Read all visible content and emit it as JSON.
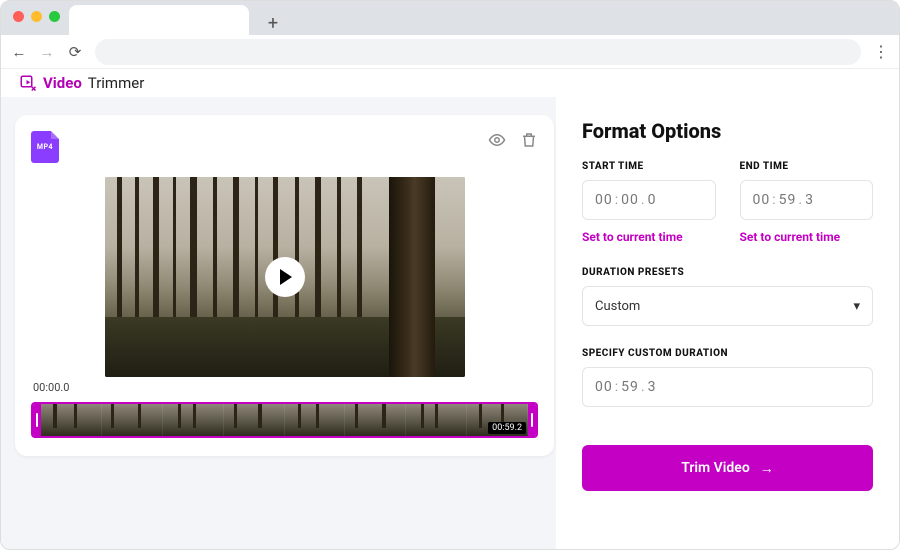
{
  "app": {
    "name1": "Video",
    "name2": "Trimmer"
  },
  "file": {
    "badge": "MP4"
  },
  "player": {
    "current_time": "00:00.0"
  },
  "timeline": {
    "end_label": "00:59.2"
  },
  "panel": {
    "title": "Format Options",
    "start": {
      "label": "START TIME",
      "hh": "00",
      "mm": "00",
      "d": "0",
      "link": "Set to current time"
    },
    "end": {
      "label": "END TIME",
      "hh": "00",
      "mm": "59",
      "d": "3",
      "link": "Set to current time"
    },
    "presets": {
      "label": "DURATION PRESETS",
      "value": "Custom"
    },
    "custom": {
      "label": "SPECIFY CUSTOM DURATION",
      "hh": "00",
      "mm": "59",
      "d": "3"
    },
    "cta": "Trim Video"
  }
}
